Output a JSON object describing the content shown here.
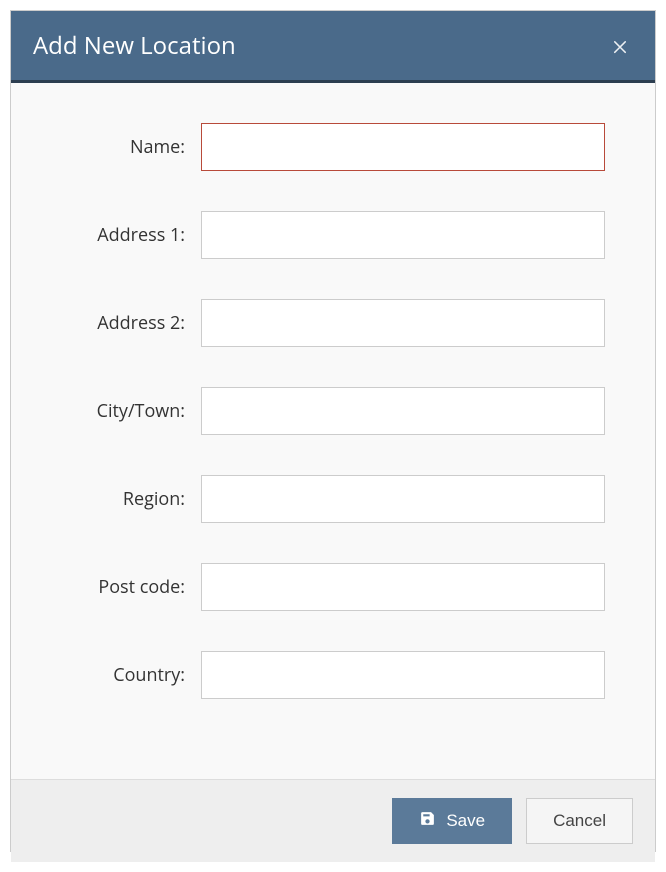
{
  "dialog": {
    "title": "Add New Location"
  },
  "fields": {
    "name": {
      "label": "Name:",
      "value": "",
      "required": true
    },
    "address1": {
      "label": "Address 1:",
      "value": ""
    },
    "address2": {
      "label": "Address 2:",
      "value": ""
    },
    "city": {
      "label": "City/Town:",
      "value": ""
    },
    "region": {
      "label": "Region:",
      "value": ""
    },
    "postcode": {
      "label": "Post code:",
      "value": ""
    },
    "country": {
      "label": "Country:",
      "value": ""
    }
  },
  "footer": {
    "save": "Save",
    "cancel": "Cancel"
  }
}
